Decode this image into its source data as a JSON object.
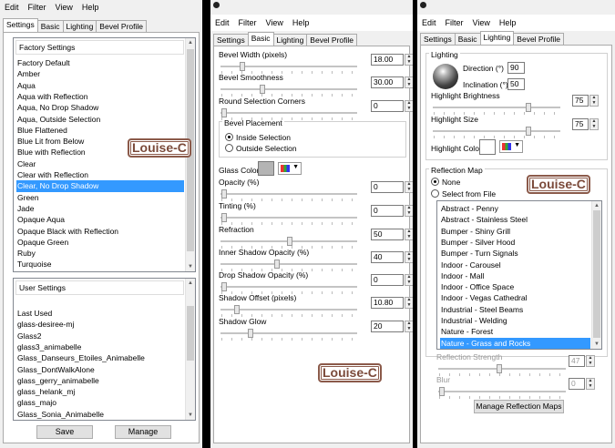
{
  "menu": [
    "Edit",
    "Filter",
    "View",
    "Help"
  ],
  "panel1": {
    "tabs": [
      "Settings",
      "Basic",
      "Lighting",
      "Bevel Profile"
    ],
    "factory": {
      "title": "Factory Settings",
      "items": [
        "Factory Default",
        "Amber",
        "Aqua",
        "Aqua with Reflection",
        "Aqua, No Drop Shadow",
        "Aqua, Outside Selection",
        "Blue Flattened",
        "Blue Lit from Below",
        "Blue with Reflection",
        "Clear",
        "Clear with Reflection",
        "Clear, No Drop Shadow",
        "Green",
        "Jade",
        "Opaque Aqua",
        "Opaque Black with Reflection",
        "Opaque Green",
        "Ruby",
        "Turquoise"
      ],
      "selected_index": 11
    },
    "user": {
      "title": "User Settings",
      "items": [
        "Last Used",
        "glass-desiree-mj",
        "Glass2",
        "glass3_animabelle",
        "Glass_Danseurs_Etoiles_Animabelle",
        "Glass_DontWalkAlone",
        "glass_gerry_animabelle",
        "glass_helank_mj",
        "glass_majo",
        "Glass_Sonia_Animabelle"
      ]
    },
    "save_label": "Save",
    "manage_label": "Manage",
    "watermark": "Louise-C"
  },
  "panel2": {
    "tabs": [
      "Settings",
      "Basic",
      "Lighting",
      "Bevel Profile"
    ],
    "bevel_width": {
      "label": "Bevel Width (pixels)",
      "value": "18.00",
      "level": 0.14
    },
    "bevel_smoothness": {
      "label": "Bevel Smoothness",
      "value": "30.00",
      "level": 0.29
    },
    "round_corners": {
      "label": "Round Selection Corners",
      "value": "0",
      "level": 0.0
    },
    "bevel_placement": {
      "label": "Bevel Placement",
      "inside": "Inside Selection",
      "outside": "Outside Selection"
    },
    "glass_color_label": "Glass Color",
    "opacity": {
      "label": "Opacity (%)",
      "value": "0",
      "level": 0.0
    },
    "tinting": {
      "label": "Tinting (%)",
      "value": "0",
      "level": 0.0
    },
    "refraction": {
      "label": "Refraction",
      "value": "50",
      "level": 0.5
    },
    "inner_shadow": {
      "label": "Inner Shadow Opacity (%)",
      "value": "40",
      "level": 0.4
    },
    "drop_shadow": {
      "label": "Drop Shadow Opacity (%)",
      "value": "0",
      "level": 0.0
    },
    "shadow_offset": {
      "label": "Shadow Offset (pixels)",
      "value": "10.80",
      "level": 0.1
    },
    "shadow_glow": {
      "label": "Shadow Glow",
      "value": "20",
      "level": 0.2
    },
    "watermark": "Louise-C"
  },
  "panel3": {
    "tabs": [
      "Settings",
      "Basic",
      "Lighting",
      "Bevel Profile"
    ],
    "lighting_title": "Lighting",
    "direction": {
      "label": "Direction (°)",
      "value": "90"
    },
    "inclination": {
      "label": "Inclination (°)",
      "value": "50"
    },
    "highlight_brightness": {
      "label": "Highlight Brightness",
      "value": "75",
      "level": 0.75
    },
    "highlight_size": {
      "label": "Highlight Size",
      "value": "75",
      "level": 0.75
    },
    "highlight_color_label": "Highlight Color",
    "reflection_map": {
      "title": "Reflection Map",
      "none": "None",
      "select_file": "Select from File",
      "items": [
        "Abstract - Penny",
        "Abstract - Stainless Steel",
        "Bumper - Shiny Grill",
        "Bumper - Silver Hood",
        "Bumper - Turn Signals",
        "Indoor - Carousel",
        "Indoor - Mall",
        "Indoor - Office Space",
        "Indoor - Vegas Cathedral",
        "Industrial - Steel Beams",
        "Industrial - Welding",
        "Nature - Forest",
        "Nature - Grass and Rocks"
      ],
      "selected_index": 12
    },
    "reflection_strength": {
      "label": "Reflection Strength",
      "value": "47",
      "level": 0.47
    },
    "blur": {
      "label": "Blur",
      "value": "0",
      "level": 0.0
    },
    "manage_maps_label": "Manage Reflection Maps",
    "watermark": "Louise-C"
  }
}
